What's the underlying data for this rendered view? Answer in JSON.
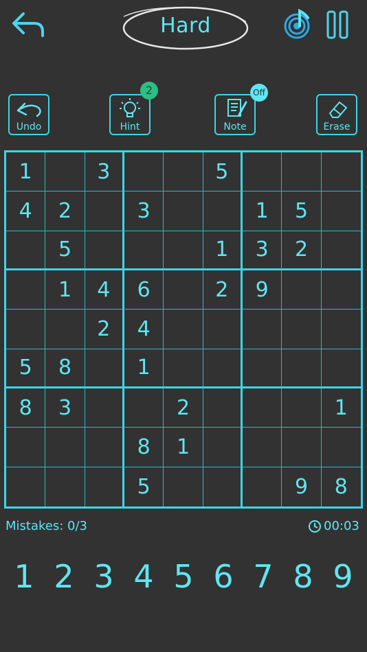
{
  "header": {
    "difficulty": "Hard",
    "back_icon": "back-arrow-icon",
    "music_icon": "music-note-icon",
    "pause_icon": "pause-icon"
  },
  "tools": {
    "undo_label": "Undo",
    "hint_label": "Hint",
    "hint_count": "2",
    "note_label": "Note",
    "note_state": "Off",
    "erase_label": "Erase"
  },
  "board": {
    "rows": [
      [
        "1",
        "",
        "3",
        "",
        "",
        "5",
        "",
        "",
        ""
      ],
      [
        "4",
        "2",
        "",
        "3",
        "",
        "",
        "1",
        "5",
        ""
      ],
      [
        "",
        "5",
        "",
        "",
        "",
        "1",
        "3",
        "2",
        ""
      ],
      [
        "",
        "1",
        "4",
        "6",
        "",
        "2",
        "9",
        "",
        ""
      ],
      [
        "",
        "",
        "2",
        "4",
        "",
        "",
        "",
        "",
        ""
      ],
      [
        "5",
        "8",
        "",
        "1",
        "",
        "",
        "",
        "",
        ""
      ],
      [
        "8",
        "3",
        "",
        "",
        "2",
        "",
        "",
        "",
        "1"
      ],
      [
        "",
        "",
        "",
        "8",
        "1",
        "",
        "",
        "",
        ""
      ],
      [
        "",
        "",
        "",
        "5",
        "",
        "",
        "",
        "9",
        "8"
      ]
    ]
  },
  "status": {
    "mistakes": "Mistakes: 0/3",
    "timer": "00:03"
  },
  "numpad": [
    "1",
    "2",
    "3",
    "4",
    "5",
    "6",
    "7",
    "8",
    "9"
  ],
  "colors": {
    "background": "#323232",
    "accent": "#5fe6f2",
    "hint_badge": "#2bbf86"
  }
}
